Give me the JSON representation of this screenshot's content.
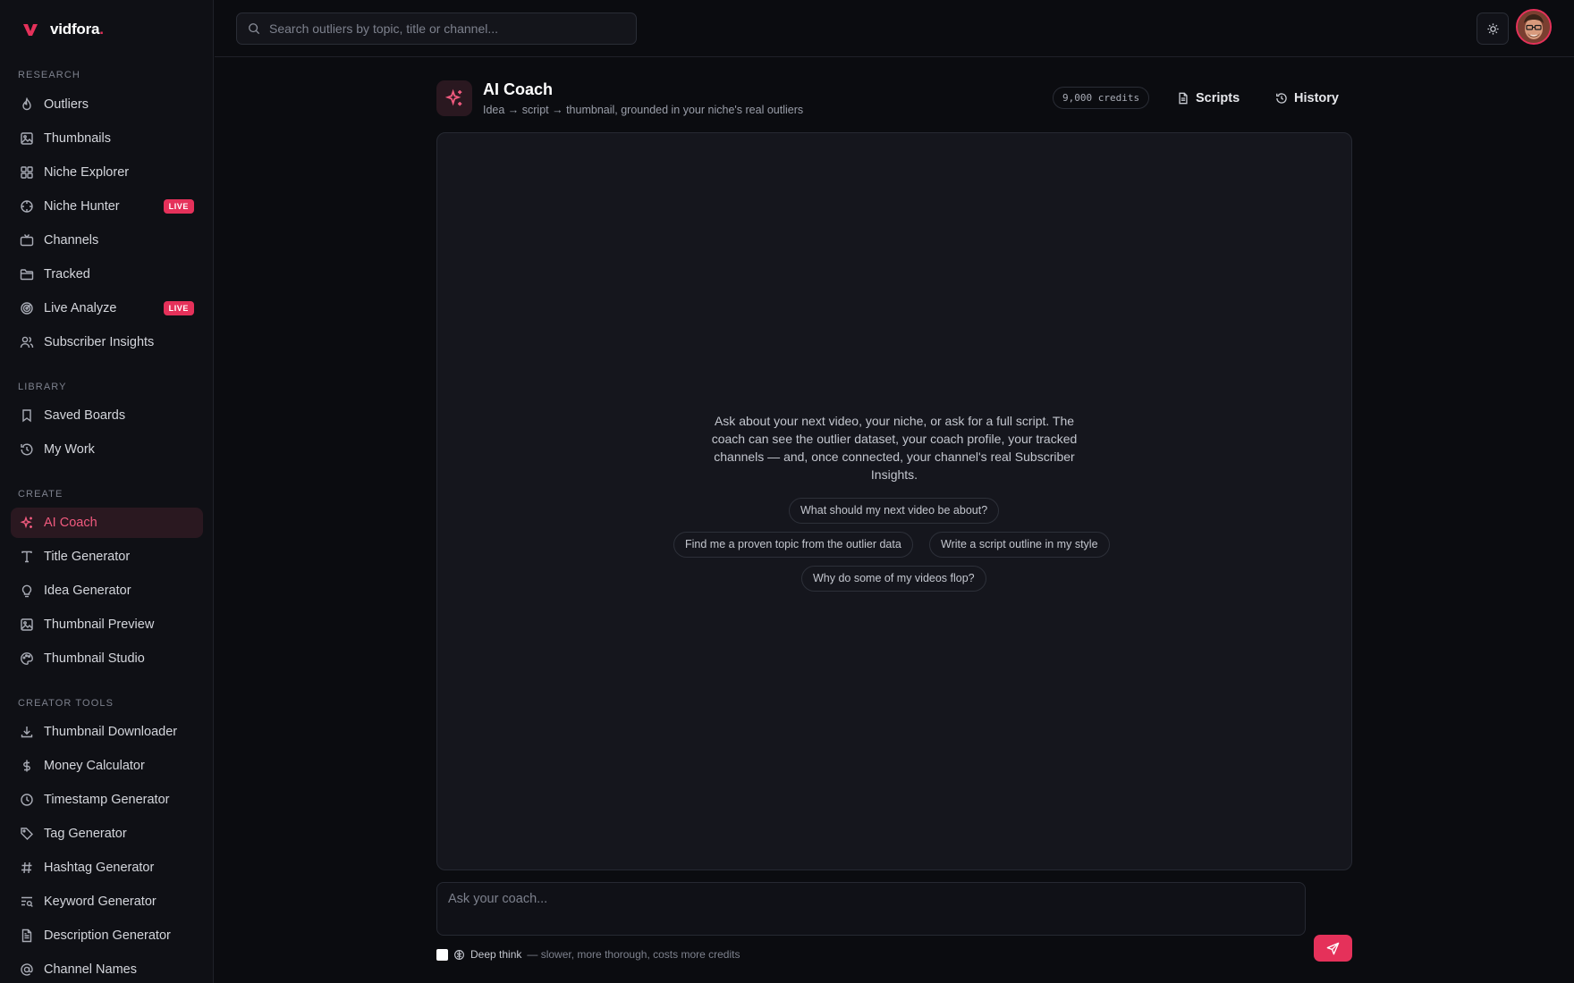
{
  "brand": {
    "name": "vidfora",
    "dot": "."
  },
  "sidebar": {
    "sections": [
      {
        "label": "RESEARCH",
        "items": [
          {
            "label": "Outliers",
            "icon": "flame-icon"
          },
          {
            "label": "Thumbnails",
            "icon": "image-icon"
          },
          {
            "label": "Niche Explorer",
            "icon": "grid-icon"
          },
          {
            "label": "Niche Hunter",
            "icon": "crosshair-icon",
            "badge": "LIVE"
          },
          {
            "label": "Channels",
            "icon": "tv-icon"
          },
          {
            "label": "Tracked",
            "icon": "folder-icon"
          },
          {
            "label": "Live Analyze",
            "icon": "radar-icon",
            "badge": "LIVE"
          },
          {
            "label": "Subscriber Insights",
            "icon": "users-icon"
          }
        ]
      },
      {
        "label": "LIBRARY",
        "items": [
          {
            "label": "Saved Boards",
            "icon": "bookmark-icon"
          },
          {
            "label": "My Work",
            "icon": "history-icon"
          }
        ]
      },
      {
        "label": "CREATE",
        "items": [
          {
            "label": "AI Coach",
            "icon": "sparkles-icon",
            "active": true
          },
          {
            "label": "Title Generator",
            "icon": "type-icon"
          },
          {
            "label": "Idea Generator",
            "icon": "lightbulb-icon"
          },
          {
            "label": "Thumbnail Preview",
            "icon": "image-icon"
          },
          {
            "label": "Thumbnail Studio",
            "icon": "palette-icon"
          }
        ]
      },
      {
        "label": "CREATOR TOOLS",
        "items": [
          {
            "label": "Thumbnail Downloader",
            "icon": "download-icon"
          },
          {
            "label": "Money Calculator",
            "icon": "dollar-icon"
          },
          {
            "label": "Timestamp Generator",
            "icon": "clock-icon"
          },
          {
            "label": "Tag Generator",
            "icon": "tag-icon"
          },
          {
            "label": "Hashtag Generator",
            "icon": "hash-icon"
          },
          {
            "label": "Keyword Generator",
            "icon": "text-search-icon"
          },
          {
            "label": "Description Generator",
            "icon": "file-text-icon"
          },
          {
            "label": "Channel Names",
            "icon": "at-sign-icon"
          }
        ]
      }
    ]
  },
  "topbar": {
    "search_placeholder": "Search outliers by topic, title or channel..."
  },
  "coach": {
    "title": "AI Coach",
    "subtitle": "Idea → script → thumbnail, grounded in your niche's real outliers",
    "credits": "9,000 credits",
    "scripts_label": "Scripts",
    "history_label": "History"
  },
  "chat": {
    "intro": "Ask about your next video, your niche, or ask for a full script. The coach can see the outlier dataset, your coach profile, your tracked channels — and, once connected, your channel's real Subscriber Insights.",
    "suggestions": [
      "What should my next video be about?",
      "Find me a proven topic from the outlier data",
      "Write a script outline in my style",
      "Why do some of my videos flop?"
    ]
  },
  "composer": {
    "placeholder": "Ask your coach...",
    "deep_think_label": "Deep think",
    "deep_think_hint": "— slower, more thorough, costs more credits"
  },
  "colors": {
    "accent": "#e5315a",
    "accent_soft": "#f05a7e",
    "background": "#0b0c10",
    "panel": "#15161d"
  }
}
